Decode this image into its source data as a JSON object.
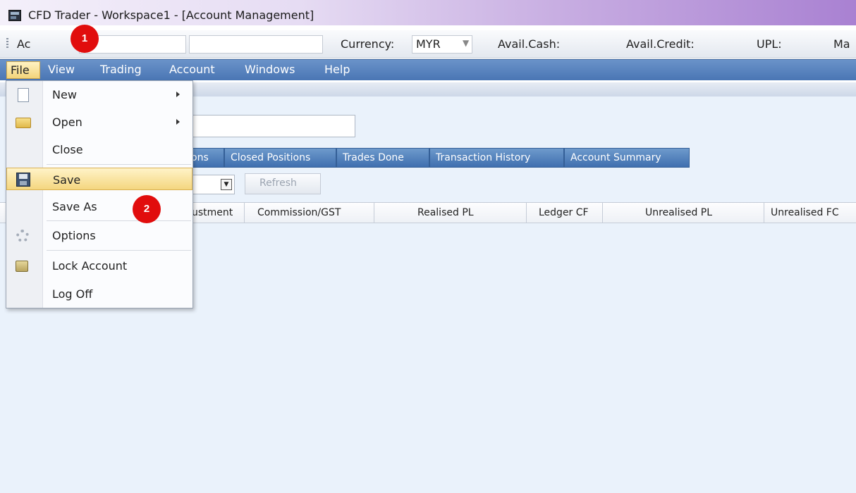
{
  "window": {
    "title": "CFD Trader - Workspace1 - [Account Management]"
  },
  "toolbar": {
    "account_label": "Ac",
    "currency_label": "Currency:",
    "currency_value": "MYR",
    "avail_cash_label": "Avail.Cash:",
    "avail_credit_label": "Avail.Credit:",
    "upl_label": "UPL:",
    "ma_label": "Ma"
  },
  "menubar": [
    "File",
    "View",
    "Trading",
    "Account",
    "Windows",
    "Help"
  ],
  "file_menu": {
    "items": [
      {
        "label": "New",
        "icon": "new-document-icon",
        "submenu": true
      },
      {
        "label": "Open",
        "icon": "folder-open-icon",
        "submenu": true
      },
      {
        "label": "Close",
        "icon": "",
        "submenu": false
      },
      {
        "label": "Save",
        "icon": "save-icon",
        "submenu": false,
        "highlighted": true
      },
      {
        "label": "Save As",
        "icon": "",
        "submenu": false
      },
      {
        "label": "Options",
        "icon": "gear-icon",
        "submenu": false
      },
      {
        "label": "Lock Account",
        "icon": "lock-icon",
        "submenu": false
      },
      {
        "label": "Log Off",
        "icon": "",
        "submenu": false
      }
    ]
  },
  "tabs": [
    "ons",
    "Closed Positions",
    "Trades Done",
    "Transaction History",
    "Account Summary"
  ],
  "refresh_label": "Refresh",
  "table": {
    "headers": [
      "ustment",
      "Commission/GST",
      "Realised PL",
      "Ledger CF",
      "Unrealised PL",
      "Unrealised FC"
    ]
  },
  "markers": [
    "1",
    "2"
  ],
  "colors": {
    "menubar": "#4a76b4",
    "highlight": "#f4d67f",
    "marker": "#e10d0d"
  }
}
